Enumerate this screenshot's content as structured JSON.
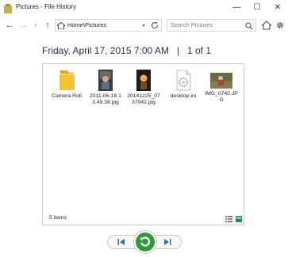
{
  "window": {
    "title": "Pictures - File History",
    "minimize_glyph": "—",
    "maximize_glyph": "☐",
    "close_glyph": "✕"
  },
  "navigation": {
    "back_glyph": "←",
    "forward_glyph": "→",
    "recent_glyph": "▾",
    "up_glyph": "↑",
    "address": "Home\\Pictures",
    "address_dropdown_glyph": "▾",
    "search_placeholder": "Search Pictures"
  },
  "snapshot": {
    "date": "Friday, April 17, 2015 7:00 AM",
    "separator": "|",
    "position": "1 of 1"
  },
  "files": [
    {
      "name": "Camera Roll",
      "icon": "folder-icon"
    },
    {
      "name": "2011-06-18 13.49.38.jpg",
      "icon": "photo-thumbnail"
    },
    {
      "name": "20141225_0737042.jpg",
      "icon": "photo-thumbnail"
    },
    {
      "name": "desktop.ini",
      "icon": "settings-file-icon"
    },
    {
      "name": "IMG_0740.JPG",
      "icon": "photo-thumbnail"
    }
  ],
  "status": {
    "item_count": "5 items"
  },
  "colors": {
    "restore_green": "#2f9a3a",
    "folder_yellow": "#f4c430",
    "date_text": "#1f2f4f"
  }
}
